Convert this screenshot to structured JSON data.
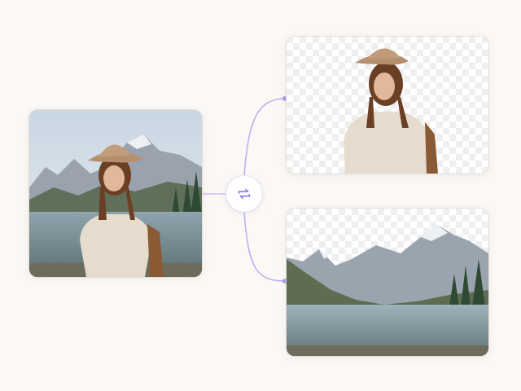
{
  "colors": {
    "background": "#fbf8f5",
    "accent": "#a99be8",
    "connector": "#b9aef0",
    "checker_light": "#ffffff",
    "checker_dark": "#eeeeee"
  },
  "icons": {
    "swap": "swap-arrows-icon"
  },
  "cards": [
    {
      "name": "original-photo",
      "content": "woman-with-mountain-lake"
    },
    {
      "name": "subject-cutout",
      "content": "woman-on-transparent-background"
    },
    {
      "name": "background-only",
      "content": "mountain-lake-scene"
    }
  ]
}
